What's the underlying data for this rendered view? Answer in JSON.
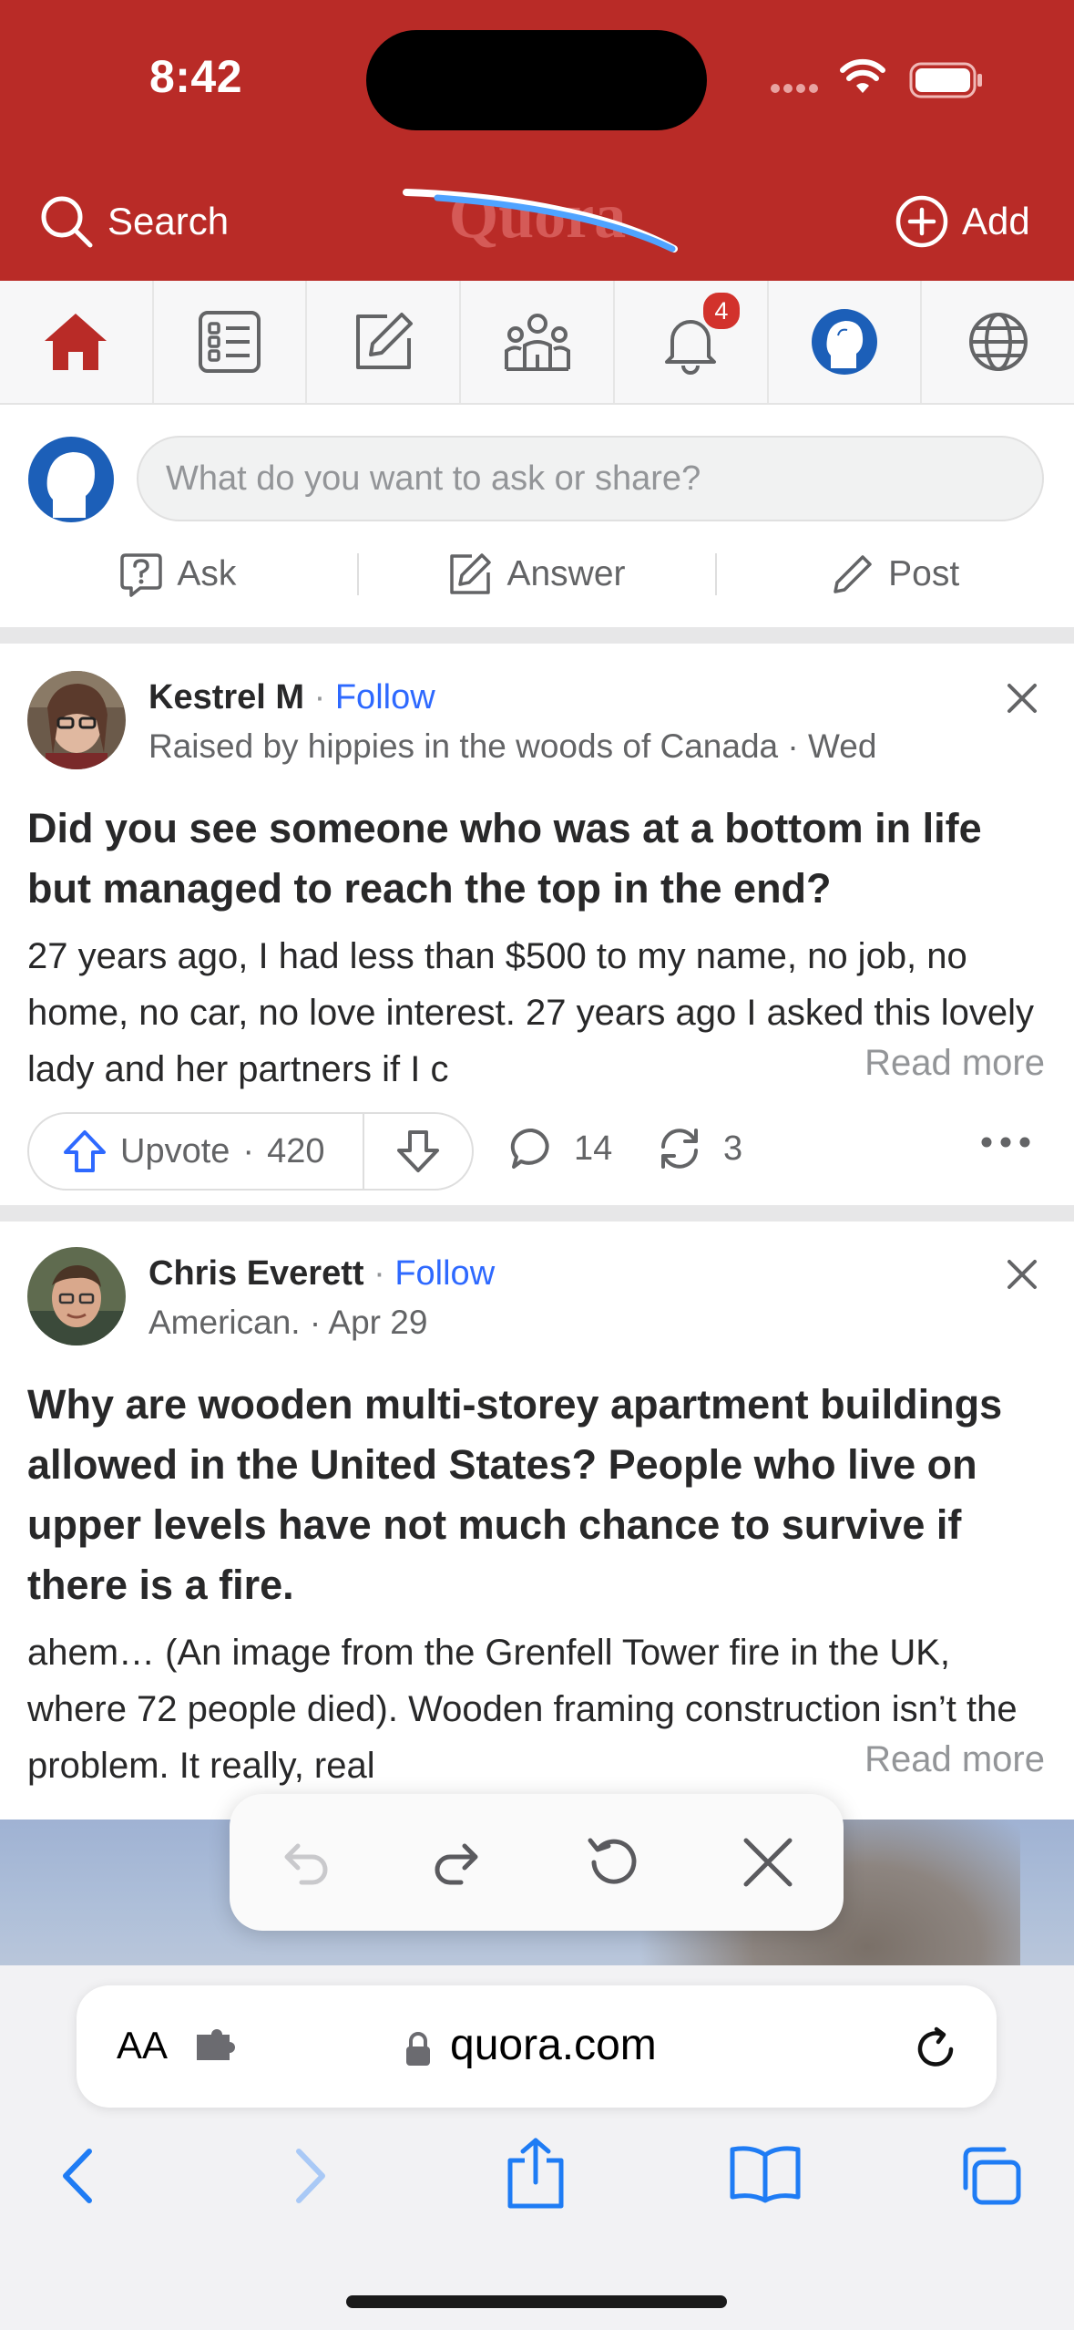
{
  "status_bar": {
    "time": "8:42"
  },
  "header": {
    "search_label": "Search",
    "logo_text": "Quora",
    "add_label": "Add",
    "bg_color": "#b92b27"
  },
  "nav": {
    "tabs": [
      {
        "name": "home",
        "icon": "home-icon",
        "active": true
      },
      {
        "name": "following",
        "icon": "list-icon"
      },
      {
        "name": "answer",
        "icon": "edit-icon"
      },
      {
        "name": "spaces",
        "icon": "people-icon"
      },
      {
        "name": "notifications",
        "icon": "bell-icon",
        "badge": "4"
      },
      {
        "name": "profile",
        "icon": "avatar-icon"
      },
      {
        "name": "languages",
        "icon": "globe-icon"
      }
    ]
  },
  "composer": {
    "placeholder": "What do you want to ask or share?",
    "actions": {
      "ask": "Ask",
      "answer": "Answer",
      "post": "Post"
    }
  },
  "feed": {
    "post1": {
      "author": "Kestrel M",
      "follow": "Follow",
      "credential": "Raised by hippies in the woods of Canada",
      "date": "Wed",
      "question": "Did you see someone who was at a bottom in life but managed to reach the top in the end?",
      "excerpt": "27 years ago, I had less than $500 to my name, no job, no home, no car, no love interest. 27 years ago I asked this lovely lady and her partners if I c",
      "read_more": "Read more",
      "upvote_label": "Upvote",
      "upvotes": "420",
      "comments": "14",
      "shares": "3"
    },
    "post2": {
      "author": "Chris Everett",
      "follow": "Follow",
      "credential": "American.",
      "date": "Apr 29",
      "question": "Why are wooden multi-storey apartment buildings allowed in the United States? People who live on upper levels have not much chance to survive if there is a fire.",
      "excerpt": "ahem… (An image from the Grenfell Tower fire in the UK, where 72 people died). Wooden framing construction isn’t the problem. It really, real",
      "read_more": "Read more"
    },
    "separator_dot": "·"
  },
  "safari": {
    "text_size_label": "AA",
    "url": "quora.com"
  },
  "colors": {
    "quora_red": "#b92b27",
    "link_blue": "#2e69ff",
    "safari_blue": "#1f7cf4"
  }
}
